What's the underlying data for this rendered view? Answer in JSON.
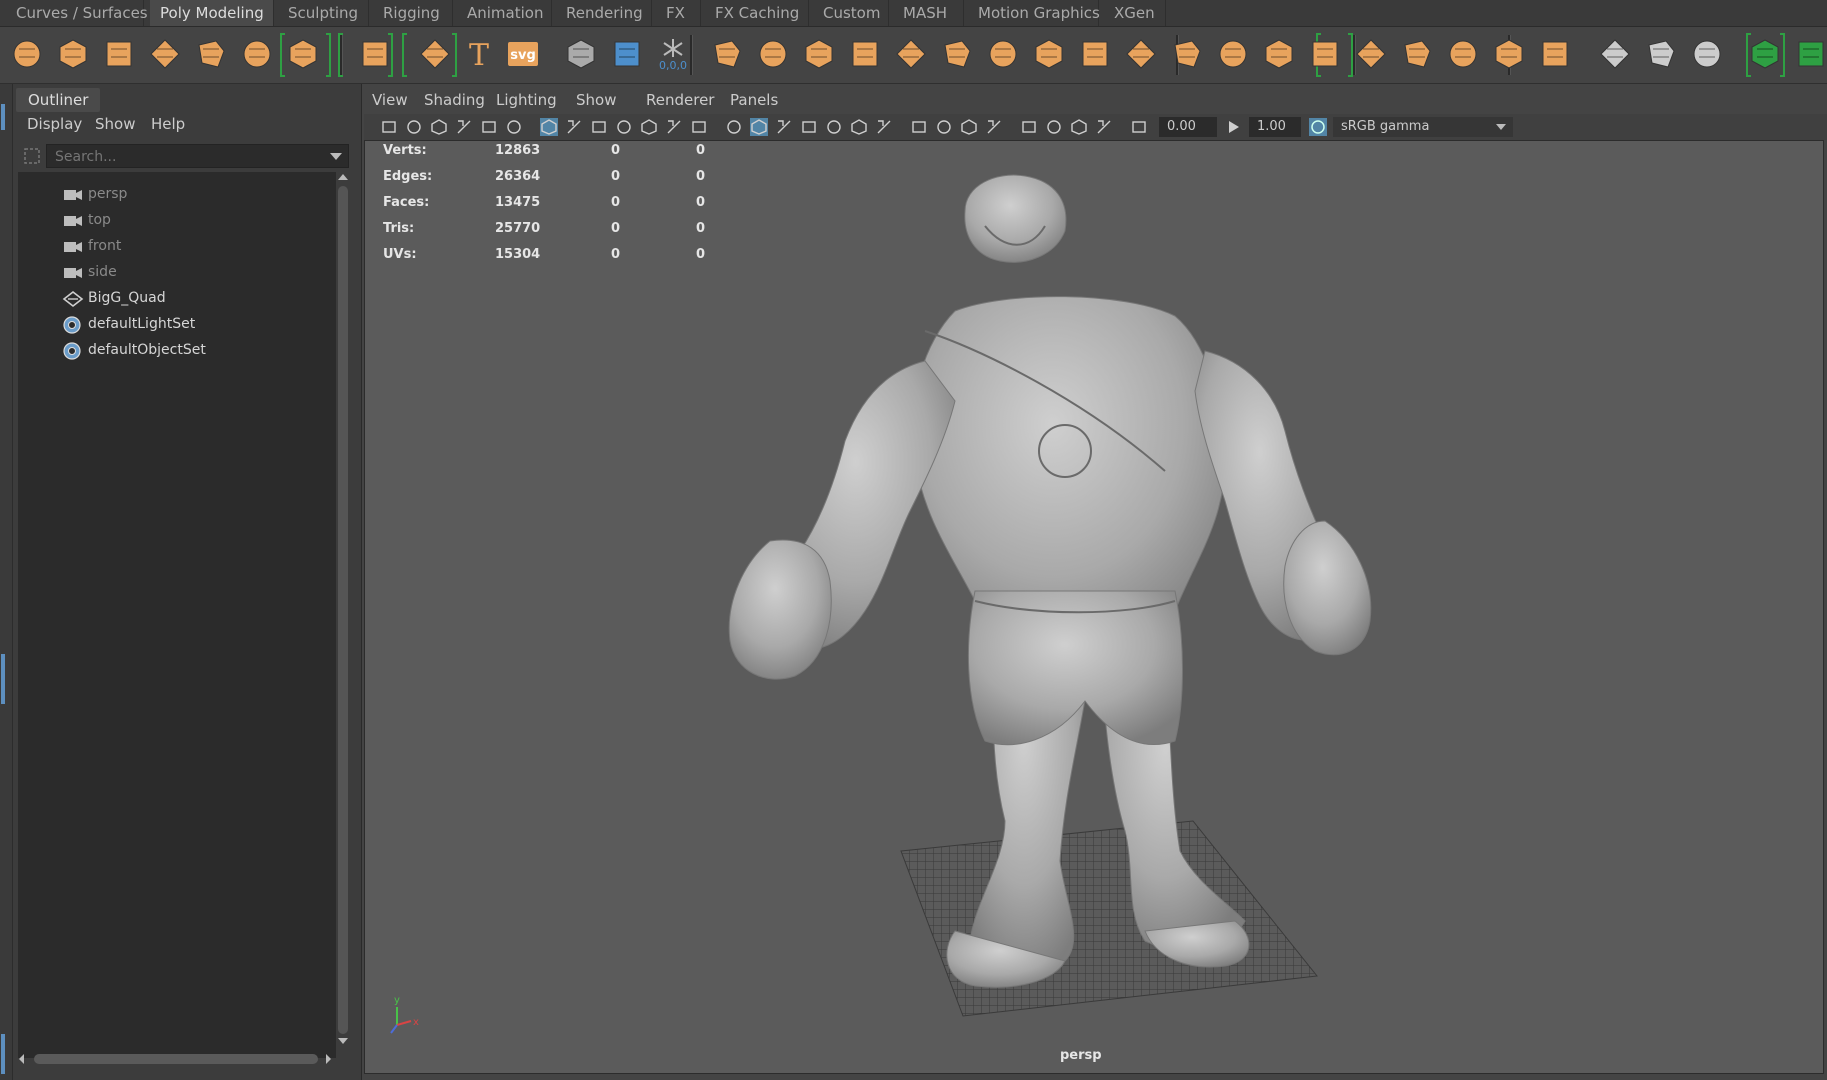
{
  "shelf_tabs": [
    "Curves / Surfaces",
    "Poly Modeling",
    "Sculpting",
    "Rigging",
    "Animation",
    "Rendering",
    "FX",
    "FX Caching",
    "Custom",
    "MASH",
    "Motion Graphics",
    "XGen"
  ],
  "shelf_active": "Poly Modeling",
  "shelf_icons": [
    "poly-sphere-icon",
    "poly-cube-icon",
    "poly-cylinder-icon",
    "poly-cone-icon",
    "poly-torus-icon",
    "poly-plane-icon",
    "poly-disc-icon",
    "platonic-solid-icon",
    "super-shape-icon",
    "type-tool-icon",
    "svg-tool-icon",
    "snap-icon",
    "measure-icon",
    "freeze-transform-icon",
    "combine-icon",
    "separate-icon",
    "mirror-icon",
    "smooth-icon",
    "extrude-icon",
    "bridge-icon",
    "bevel-icon",
    "append-icon",
    "wedge-icon",
    "poke-icon",
    "fill-hole-icon",
    "multi-cut-icon",
    "target-weld-icon",
    "bridge-edge-icon",
    "insert-edgeloop-icon",
    "offset-edgeloop-icon",
    "connect-icon",
    "knife-icon",
    "uv-layout-icon",
    "uv-planar-icon",
    "uv-cylindrical-icon",
    "uv-spherical-icon",
    "uv-auto-icon",
    "uv-transfer-icon",
    "checker-icon",
    "unfold-icon"
  ],
  "shelf_svg_label": "svg",
  "shelf_type_label": "T",
  "shelf_snap_label": "0,0,0",
  "outliner": {
    "title": "Outliner",
    "menu": [
      "Display",
      "Show",
      "Help"
    ],
    "search_placeholder": "Search...",
    "items": [
      {
        "label": "persp",
        "icon": "camera-icon",
        "dim": true
      },
      {
        "label": "top",
        "icon": "camera-icon",
        "dim": true
      },
      {
        "label": "front",
        "icon": "camera-icon",
        "dim": true
      },
      {
        "label": "side",
        "icon": "camera-icon",
        "dim": true
      },
      {
        "label": "BigG_Quad",
        "icon": "mesh-icon",
        "dim": false
      },
      {
        "label": "defaultLightSet",
        "icon": "set-icon",
        "dim": false
      },
      {
        "label": "defaultObjectSet",
        "icon": "set-icon",
        "dim": false
      }
    ]
  },
  "viewport": {
    "menu": [
      "View",
      "Shading",
      "Lighting",
      "Show",
      "Renderer",
      "Panels"
    ],
    "exposure": "0.00",
    "gamma": "1.00",
    "color_space": "sRGB gamma",
    "camera": "persp",
    "hud": [
      {
        "label": "Verts:",
        "value": "12863",
        "sel": "0",
        "comp": "0"
      },
      {
        "label": "Edges:",
        "value": "26364",
        "sel": "0",
        "comp": "0"
      },
      {
        "label": "Faces:",
        "value": "13475",
        "sel": "0",
        "comp": "0"
      },
      {
        "label": "Tris:",
        "value": "25770",
        "sel": "0",
        "comp": "0"
      },
      {
        "label": "UVs:",
        "value": "15304",
        "sel": "0",
        "comp": "0"
      }
    ],
    "axis_labels": {
      "x": "x",
      "y": "y"
    }
  },
  "colors": {
    "accent_orange": "#e8a35d",
    "accent_green": "#2ea043",
    "accent_blue": "#4d8fcc"
  }
}
